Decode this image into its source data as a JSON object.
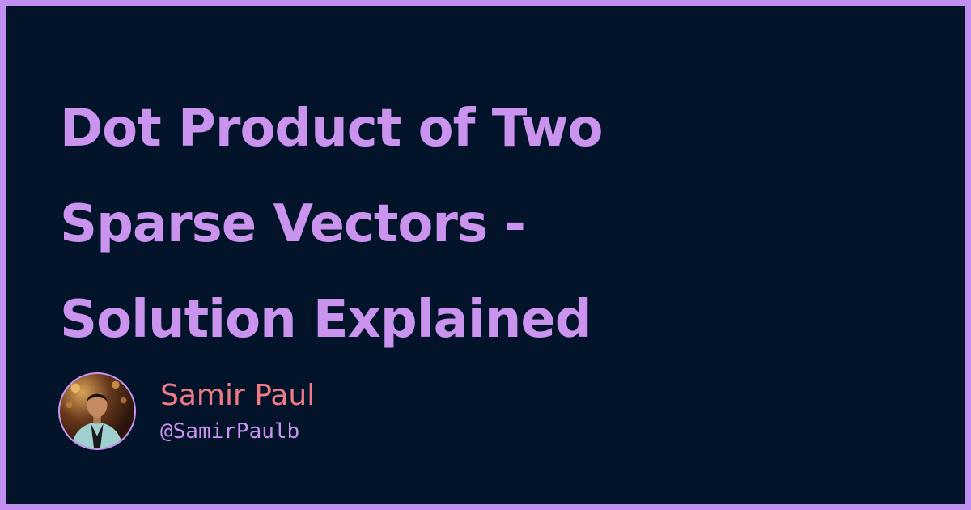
{
  "title": {
    "lines": [
      "Dot Product of Two",
      "Sparse Vectors -",
      "Solution Explained"
    ]
  },
  "author": {
    "name": "Samir Paul",
    "handle": "@SamirPaulb",
    "avatar_icon": "profile-photo"
  },
  "colors": {
    "frame": "#c08ff0",
    "background": "#03142a",
    "title": "#c993ee",
    "name": "#ee7b86",
    "handle": "#c993ee"
  }
}
